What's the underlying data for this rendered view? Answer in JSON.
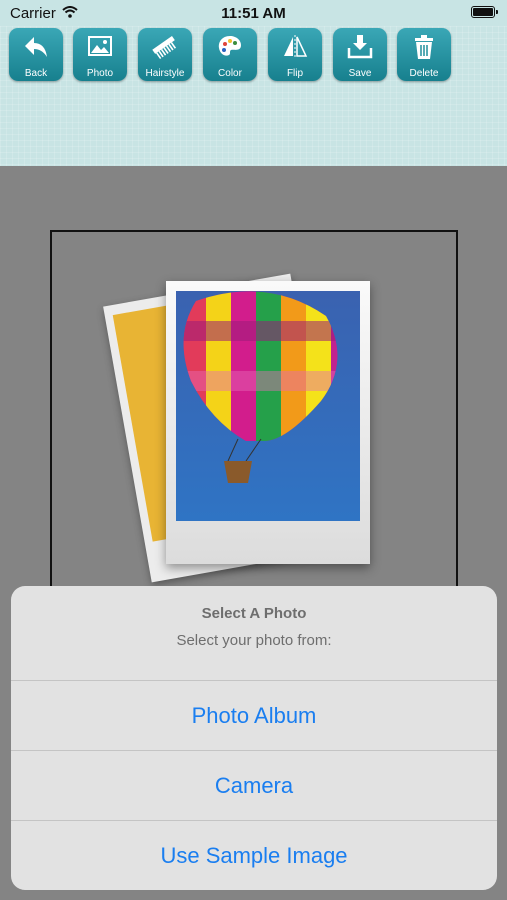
{
  "status_bar": {
    "carrier": "Carrier",
    "time": "11:51 AM"
  },
  "toolbar": {
    "buttons": [
      {
        "label": "Back",
        "icon": "back-arrow-icon"
      },
      {
        "label": "Photo",
        "icon": "photo-icon"
      },
      {
        "label": "Hairstyle",
        "icon": "comb-icon"
      },
      {
        "label": "Color",
        "icon": "palette-icon"
      },
      {
        "label": "Flip",
        "icon": "flip-icon"
      },
      {
        "label": "Save",
        "icon": "save-icon"
      },
      {
        "label": "Delete",
        "icon": "trash-icon"
      }
    ],
    "accent": "#1f8f9c",
    "background": "#c8e4e4"
  },
  "canvas": {
    "placeholder_icon": "photo-placeholder-icon"
  },
  "action_sheet": {
    "title": "Select A Photo",
    "message": "Select your photo from:",
    "options": [
      "Photo Album",
      "Camera",
      "Use Sample Image"
    ],
    "option_color": "#1a7ef0"
  }
}
